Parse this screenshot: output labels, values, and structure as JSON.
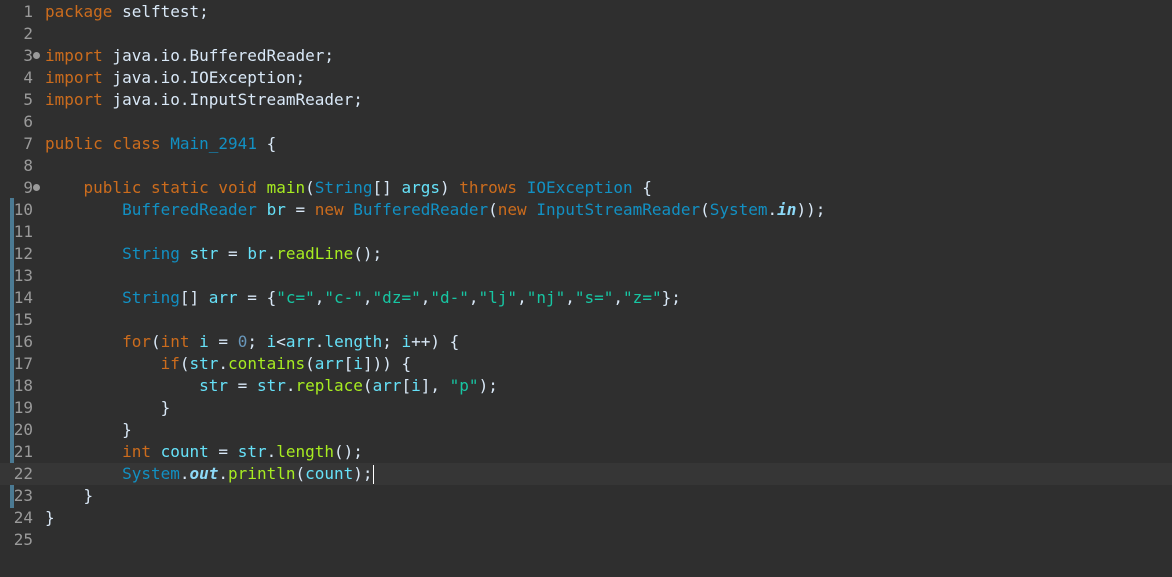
{
  "editor": {
    "language": "Java",
    "cursor_line": 22,
    "lines": [
      {
        "n": "1",
        "tokens": [
          [
            "package",
            "kw"
          ],
          [
            " selftest;",
            "pl"
          ]
        ]
      },
      {
        "n": "2",
        "tokens": []
      },
      {
        "n": "3",
        "fold": true,
        "tokens": [
          [
            "import",
            "kw"
          ],
          [
            " java.io.BufferedReader;",
            "pl"
          ]
        ]
      },
      {
        "n": "4",
        "tokens": [
          [
            "import",
            "kw"
          ],
          [
            " java.io.IOException;",
            "pl"
          ]
        ]
      },
      {
        "n": "5",
        "tokens": [
          [
            "import",
            "kw"
          ],
          [
            " java.io.InputStreamReader;",
            "pl"
          ]
        ]
      },
      {
        "n": "6",
        "tokens": []
      },
      {
        "n": "7",
        "tokens": [
          [
            "public",
            "kw"
          ],
          [
            " ",
            "pl"
          ],
          [
            "class",
            "kw"
          ],
          [
            " ",
            "pl"
          ],
          [
            "Main_2941",
            "ty"
          ],
          [
            " {",
            "pl"
          ]
        ]
      },
      {
        "n": "8",
        "tokens": []
      },
      {
        "n": "9",
        "fold": true,
        "tokens": [
          [
            "    ",
            "pl"
          ],
          [
            "public",
            "kw"
          ],
          [
            " ",
            "pl"
          ],
          [
            "static",
            "kw"
          ],
          [
            " ",
            "pl"
          ],
          [
            "void",
            "kw"
          ],
          [
            " ",
            "pl"
          ],
          [
            "main",
            "fn"
          ],
          [
            "(",
            "pl"
          ],
          [
            "String",
            "ty"
          ],
          [
            "[] ",
            "pl"
          ],
          [
            "args",
            "fd"
          ],
          [
            ") ",
            "pl"
          ],
          [
            "throws",
            "kw"
          ],
          [
            " ",
            "pl"
          ],
          [
            "IOException",
            "ty"
          ],
          [
            " {",
            "pl"
          ]
        ]
      },
      {
        "n": "10",
        "tokens": [
          [
            "        ",
            "pl"
          ],
          [
            "BufferedReader",
            "ty"
          ],
          [
            " ",
            "pl"
          ],
          [
            "br",
            "fd"
          ],
          [
            " = ",
            "pl"
          ],
          [
            "new",
            "kw"
          ],
          [
            " ",
            "pl"
          ],
          [
            "BufferedReader",
            "ty"
          ],
          [
            "(",
            "pl"
          ],
          [
            "new",
            "kw"
          ],
          [
            " ",
            "pl"
          ],
          [
            "InputStreamReader",
            "ty"
          ],
          [
            "(",
            "pl"
          ],
          [
            "System",
            "ty"
          ],
          [
            ".",
            "pl"
          ],
          [
            "in",
            "sf"
          ],
          [
            "));",
            "pl"
          ]
        ]
      },
      {
        "n": "11",
        "tokens": []
      },
      {
        "n": "12",
        "tokens": [
          [
            "        ",
            "pl"
          ],
          [
            "String",
            "ty"
          ],
          [
            " ",
            "pl"
          ],
          [
            "str",
            "fd"
          ],
          [
            " = ",
            "pl"
          ],
          [
            "br",
            "fd"
          ],
          [
            ".",
            "pl"
          ],
          [
            "readLine",
            "fn"
          ],
          [
            "();",
            "pl"
          ]
        ]
      },
      {
        "n": "13",
        "tokens": []
      },
      {
        "n": "14",
        "tokens": [
          [
            "        ",
            "pl"
          ],
          [
            "String",
            "ty"
          ],
          [
            "[] ",
            "pl"
          ],
          [
            "arr",
            "fd"
          ],
          [
            " = {",
            "pl"
          ],
          [
            "\"c=\"",
            "st"
          ],
          [
            ",",
            "pl"
          ],
          [
            "\"c-\"",
            "st"
          ],
          [
            ",",
            "pl"
          ],
          [
            "\"dz=\"",
            "st"
          ],
          [
            ",",
            "pl"
          ],
          [
            "\"d-\"",
            "st"
          ],
          [
            ",",
            "pl"
          ],
          [
            "\"lj\"",
            "st"
          ],
          [
            ",",
            "pl"
          ],
          [
            "\"nj\"",
            "st"
          ],
          [
            ",",
            "pl"
          ],
          [
            "\"s=\"",
            "st"
          ],
          [
            ",",
            "pl"
          ],
          [
            "\"z=\"",
            "st"
          ],
          [
            "};",
            "pl"
          ]
        ]
      },
      {
        "n": "15",
        "tokens": []
      },
      {
        "n": "16",
        "tokens": [
          [
            "        ",
            "pl"
          ],
          [
            "for",
            "kw"
          ],
          [
            "(",
            "pl"
          ],
          [
            "int",
            "kw"
          ],
          [
            " ",
            "pl"
          ],
          [
            "i",
            "fd"
          ],
          [
            " = ",
            "pl"
          ],
          [
            "0",
            "nm"
          ],
          [
            "; ",
            "pl"
          ],
          [
            "i",
            "fd"
          ],
          [
            "<",
            "pl"
          ],
          [
            "arr",
            "fd"
          ],
          [
            ".",
            "pl"
          ],
          [
            "length",
            "fd"
          ],
          [
            "; ",
            "pl"
          ],
          [
            "i",
            "fd"
          ],
          [
            "++) {",
            "pl"
          ]
        ]
      },
      {
        "n": "17",
        "tokens": [
          [
            "            ",
            "pl"
          ],
          [
            "if",
            "kw"
          ],
          [
            "(",
            "pl"
          ],
          [
            "str",
            "fd"
          ],
          [
            ".",
            "pl"
          ],
          [
            "contains",
            "fn"
          ],
          [
            "(",
            "pl"
          ],
          [
            "arr",
            "fd"
          ],
          [
            "[",
            "pl"
          ],
          [
            "i",
            "fd"
          ],
          [
            "])) {",
            "pl"
          ]
        ]
      },
      {
        "n": "18",
        "tokens": [
          [
            "                ",
            "pl"
          ],
          [
            "str",
            "fd"
          ],
          [
            " = ",
            "pl"
          ],
          [
            "str",
            "fd"
          ],
          [
            ".",
            "pl"
          ],
          [
            "replace",
            "fn"
          ],
          [
            "(",
            "pl"
          ],
          [
            "arr",
            "fd"
          ],
          [
            "[",
            "pl"
          ],
          [
            "i",
            "fd"
          ],
          [
            "], ",
            "pl"
          ],
          [
            "\"p\"",
            "st"
          ],
          [
            ");",
            "pl"
          ]
        ]
      },
      {
        "n": "19",
        "tokens": [
          [
            "            }",
            "pl"
          ]
        ]
      },
      {
        "n": "20",
        "tokens": [
          [
            "        }",
            "pl"
          ]
        ]
      },
      {
        "n": "21",
        "tokens": [
          [
            "        ",
            "pl"
          ],
          [
            "int",
            "kw"
          ],
          [
            " ",
            "pl"
          ],
          [
            "count",
            "fd"
          ],
          [
            " = ",
            "pl"
          ],
          [
            "str",
            "fd"
          ],
          [
            ".",
            "pl"
          ],
          [
            "length",
            "fn"
          ],
          [
            "();",
            "pl"
          ]
        ]
      },
      {
        "n": "22",
        "tokens": [
          [
            "        ",
            "pl"
          ],
          [
            "System",
            "ty"
          ],
          [
            ".",
            "pl"
          ],
          [
            "out",
            "sf"
          ],
          [
            ".",
            "pl"
          ],
          [
            "println",
            "fn"
          ],
          [
            "(",
            "pl"
          ],
          [
            "count",
            "fd"
          ],
          [
            ");",
            "pl"
          ]
        ]
      },
      {
        "n": "23",
        "tokens": [
          [
            "    }",
            "pl"
          ]
        ]
      },
      {
        "n": "24",
        "tokens": [
          [
            "}",
            "pl"
          ]
        ]
      },
      {
        "n": "25",
        "tokens": []
      }
    ]
  }
}
